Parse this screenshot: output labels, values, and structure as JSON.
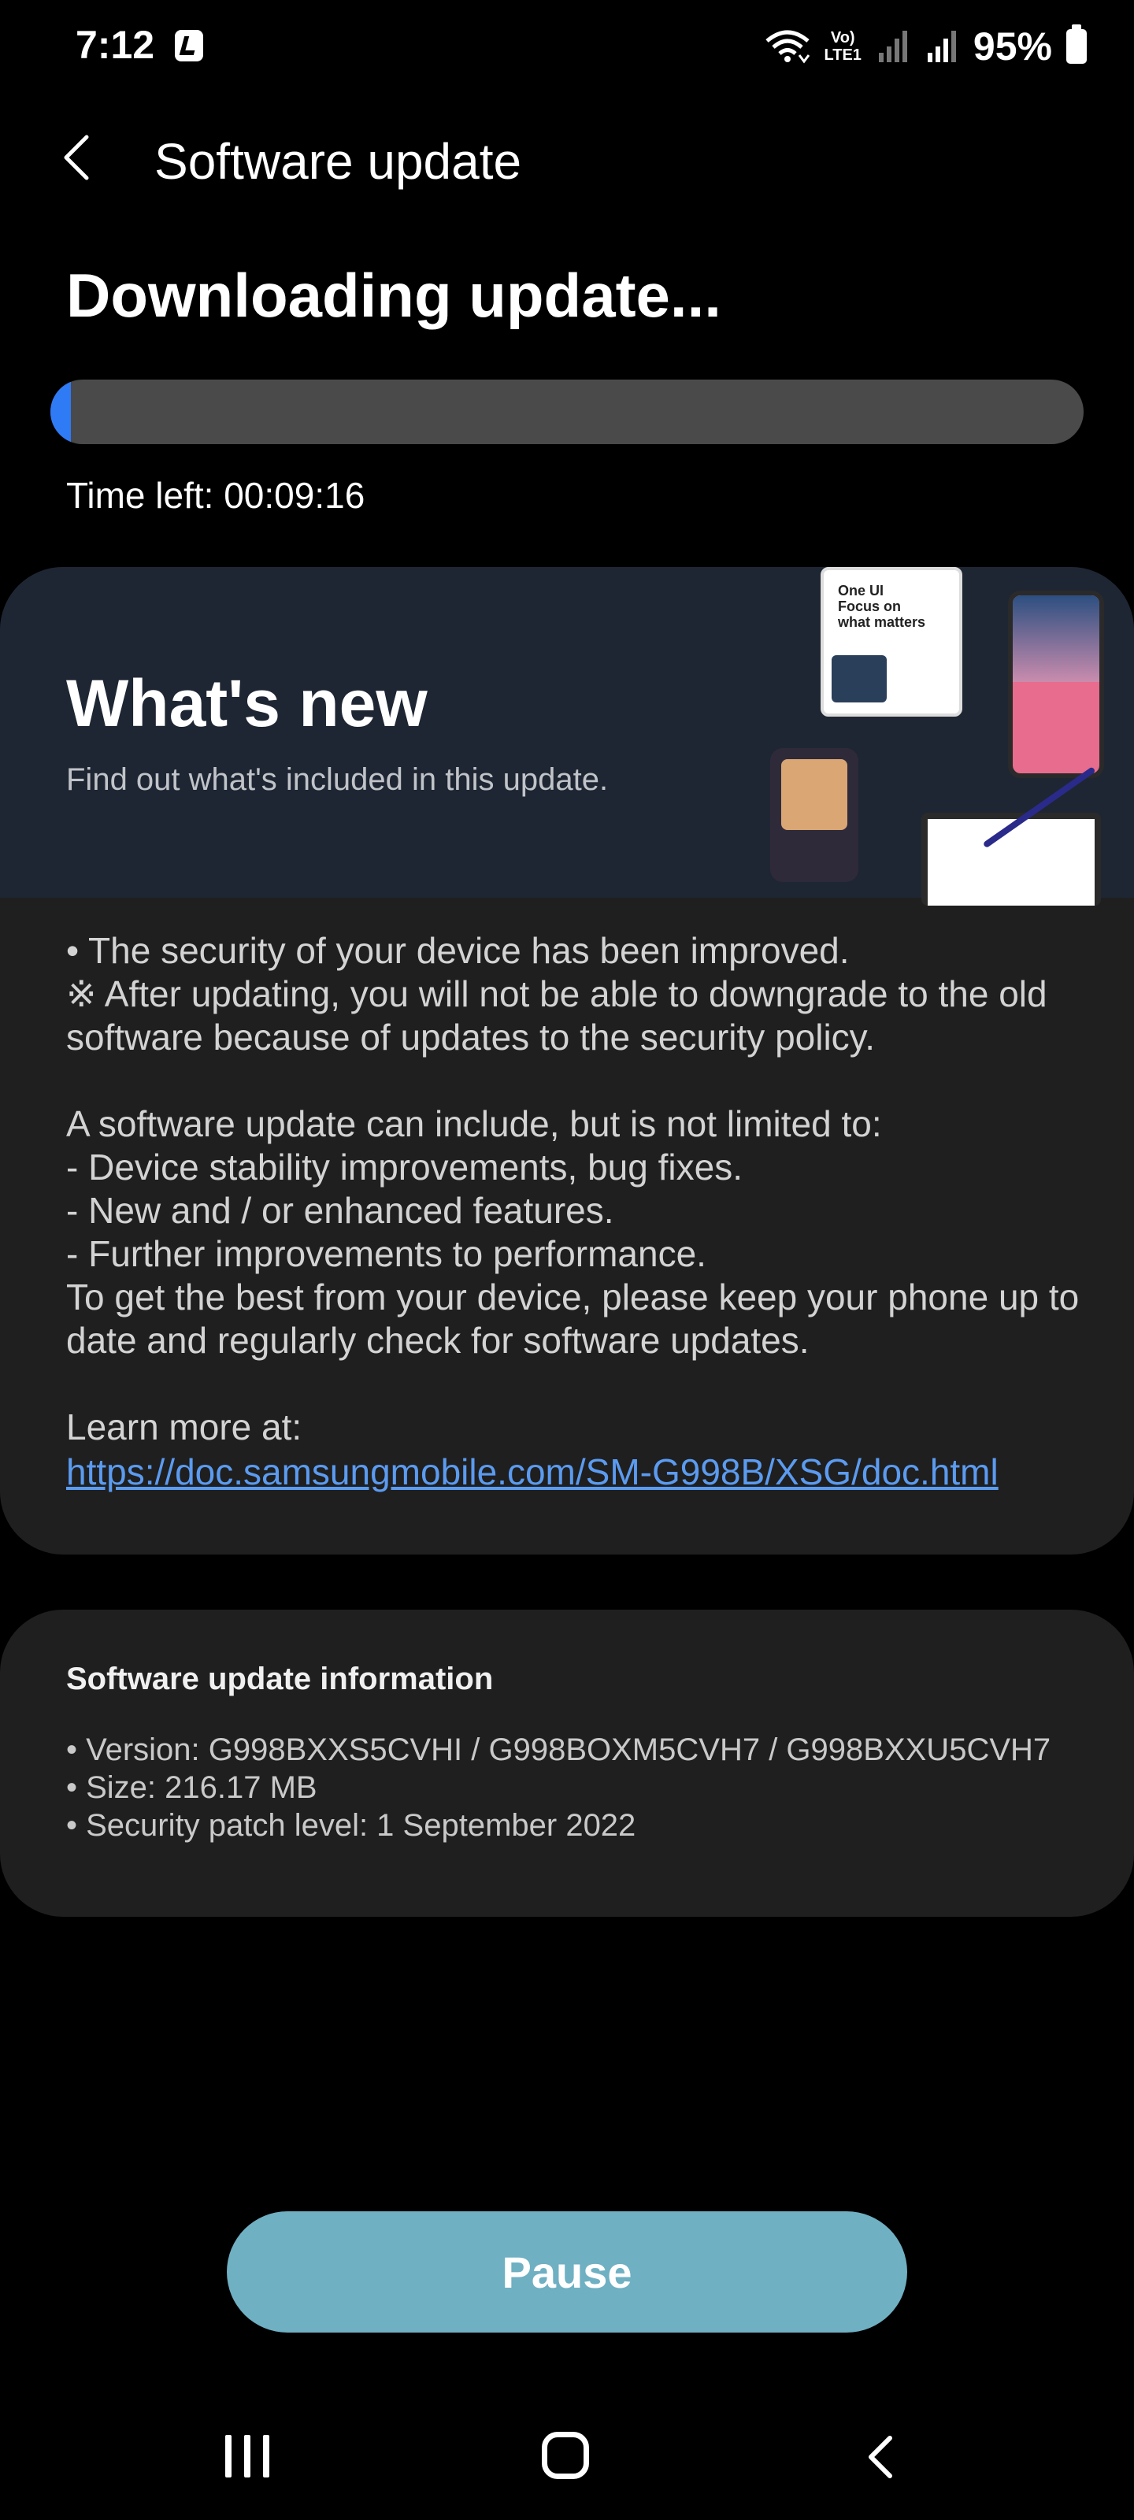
{
  "status_bar": {
    "time": "7:12",
    "volte": "Vo)",
    "lte": "LTE1",
    "battery": "95%",
    "icons": [
      "music-note-app-icon",
      "wifi-icon",
      "volte-icon",
      "signal-icon",
      "signal-icon",
      "battery-icon"
    ]
  },
  "header": {
    "back_icon": "chevron-left-icon",
    "title": "Software update"
  },
  "download": {
    "title": "Downloading update...",
    "progress_percent": 2,
    "time_left": "Time left: 00:09:16"
  },
  "whats_new": {
    "title": "What's new",
    "subtitle": "Find out what's included in this update.",
    "illustration_text": "One UI\nFocus on\nwhat matters",
    "body": "• The security of your device has been improved.\n※ After updating, you will not be able to downgrade to the old software because of updates to the security policy.\n\nA software update can include, but is not limited to:\n - Device stability improvements, bug fixes.\n - New and / or enhanced features.\n - Further improvements to performance.\nTo get the best from your device, please keep your phone up to date and regularly check for software updates.\n\nLearn more at:",
    "link": "https://doc.samsungmobile.com/SM-G998B/XSG/doc.html"
  },
  "info": {
    "title": "Software update information",
    "items": [
      "• Version: G998BXXS5CVHI / G998BOXM5CVH7 / G998BXXU5CVH7",
      "• Size: 216.17 MB",
      "• Security patch level: 1 September 2022"
    ]
  },
  "pause_label": "Pause",
  "nav_bar": {
    "icons": [
      "recent-apps-icon",
      "home-icon",
      "back-icon"
    ]
  },
  "colors": {
    "background": "#000000",
    "accent": "#2f7bf5",
    "link": "#5b9bf0",
    "card": "#1f1f1f",
    "banner": "#1e2633",
    "pause_button": "#6fb0c3"
  }
}
